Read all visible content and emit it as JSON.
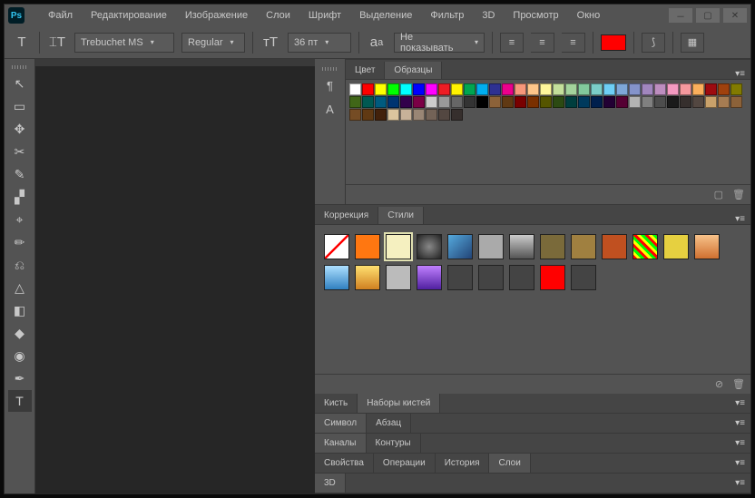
{
  "app": {
    "name": "Ps"
  },
  "menubar": [
    "Файл",
    "Редактирование",
    "Изображение",
    "Слои",
    "Шрифт",
    "Выделение",
    "Фильтр",
    "3D",
    "Просмотр",
    "Окно"
  ],
  "options": {
    "font_family": "Trebuchet MS",
    "font_style": "Regular",
    "font_size": "36 пт",
    "aa_label": "Не показывать"
  },
  "panels": {
    "color_tabs": [
      "Цвет",
      "Образцы"
    ],
    "color_active": 1,
    "correction_tabs": [
      "Коррекция",
      "Стили"
    ],
    "correction_active": 1,
    "brush_tabs": [
      "Кисть",
      "Наборы кистей"
    ],
    "brush_active": 1,
    "symbol_tabs": [
      "Символ",
      "Абзац"
    ],
    "symbol_active": 0,
    "channels_tabs": [
      "Каналы",
      "Контуры"
    ],
    "channels_active": 0,
    "layers_tabs": [
      "Свойства",
      "Операции",
      "История",
      "Слои"
    ],
    "layers_active": 3,
    "threed_tabs": [
      "3D"
    ]
  },
  "swatches_row1": [
    "#ffffff",
    "#ff0000",
    "#ffff00",
    "#00ff00",
    "#00ffff",
    "#0000ff",
    "#ff00ff",
    "#ed1c24",
    "#fff200",
    "#00a651",
    "#00aeef",
    "#2e3192",
    "#ec008c",
    "#f7977a",
    "#fdc68a",
    "#fff79a",
    "#c4df9b",
    "#a3d39c",
    "#82ca9c",
    "#7bcdc8",
    "#6ecff6",
    "#7ea7d8",
    "#8493ca",
    "#a186be",
    "#bd8dbf",
    "#f49ac1",
    "#f5989d",
    "#fbaf5c",
    "#9e0b0f",
    "#a0410d",
    "#827b00",
    "#406618",
    "#005952"
  ],
  "swatches_row2": [
    "#005b7f",
    "#003471",
    "#32004b",
    "#7b0046",
    "#cccccc",
    "#999999",
    "#666666",
    "#333333",
    "#000000",
    "#8c6239",
    "#603913",
    "#790000",
    "#7a3000",
    "#555500",
    "#2c4a12",
    "#003e3e",
    "#003a5d",
    "#001f4d",
    "#220033",
    "#550033",
    "#b3b3b3",
    "#808080",
    "#4d4d4d",
    "#1a1a1a",
    "#362f2d",
    "#534741"
  ],
  "swatches_row3": [
    "#c9a16a",
    "#a67c52",
    "#8c6239",
    "#754c24",
    "#603913",
    "#42210b",
    "#dbc59e",
    "#c7b299",
    "#998675",
    "#736357",
    "#534741",
    "#362f2d"
  ],
  "styles": [
    {
      "bg": "#fff",
      "diag": true
    },
    {
      "bg": "#ff7711"
    },
    {
      "bg": "#f5f0c0",
      "sel": true
    },
    {
      "bg": "radial-gradient(circle,#888,#222)"
    },
    {
      "bg": "linear-gradient(135deg,#5ad,#247)"
    },
    {
      "bg": "#aaa"
    },
    {
      "bg": "linear-gradient(#ccc,#555)"
    },
    {
      "bg": "#7a6a3a"
    },
    {
      "bg": "#a08040"
    },
    {
      "bg": "#c05020"
    },
    {
      "bg": "repeating-linear-gradient(45deg,#f00 0 3px,#ff0 3px 6px,#0f0 6px 9px)"
    },
    {
      "bg": "#e6d040"
    },
    {
      "bg": "linear-gradient(#f7c28a,#d07030)"
    },
    {
      "bg": "linear-gradient(#aee0ff,#3080c0)"
    },
    {
      "bg": "linear-gradient(#ffe070,#d08020)"
    },
    {
      "bg": "#bbb",
      "noise": true
    },
    {
      "bg": "linear-gradient(#c080ff,#5020a0)"
    },
    {
      "bg": "#444"
    },
    {
      "bg": "#444"
    },
    {
      "bg": "#444"
    },
    {
      "bg": "#ff0000"
    },
    {
      "bg": "#444"
    }
  ],
  "tools": [
    "↖",
    "▭",
    "✥",
    "✂",
    "✎",
    "▞",
    "⌖",
    "✏",
    "⎌",
    "△",
    "◧",
    "◆",
    "◉",
    "✒",
    "T"
  ]
}
